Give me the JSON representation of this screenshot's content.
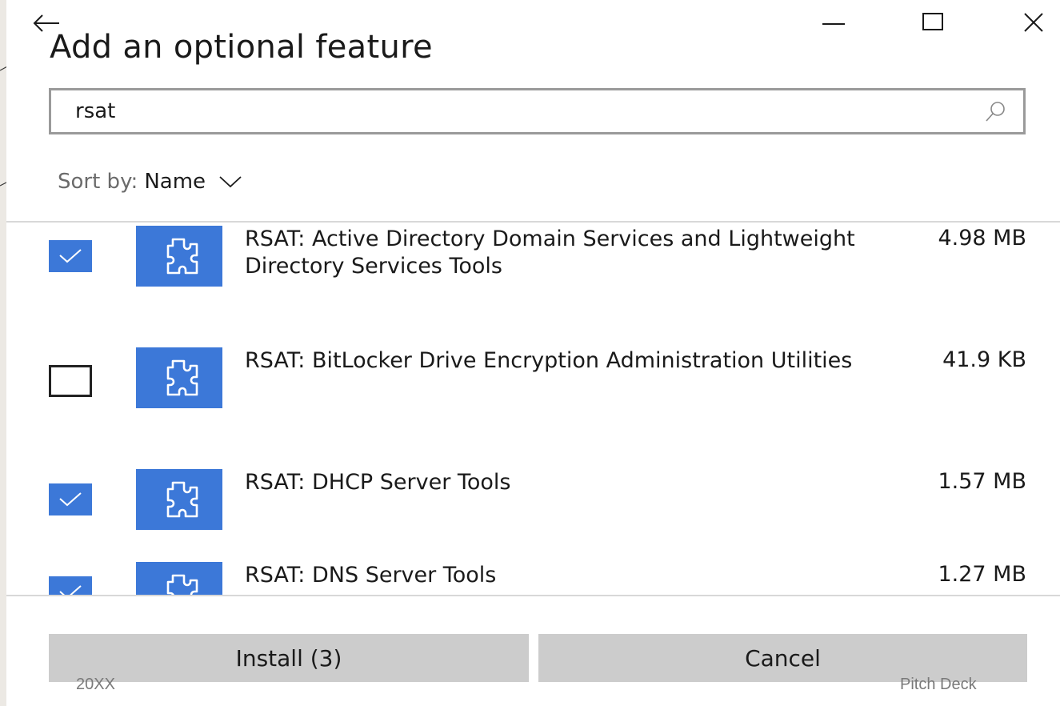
{
  "window": {
    "title": "Add an optional feature",
    "controls": [
      "minimize-icon",
      "maximize-icon",
      "close-icon"
    ],
    "back_icon": "arrow-left-icon"
  },
  "search": {
    "value": "rsat",
    "placeholder": "",
    "icon": "search-icon"
  },
  "sort": {
    "label": "Sort by:",
    "value": "Name",
    "icon": "chevron-down-icon"
  },
  "features": [
    {
      "name": "RSAT: Active Directory Domain Services and Lightweight Directory Services Tools",
      "size": "4.98 MB",
      "checked": true,
      "icon": "puzzle-icon"
    },
    {
      "name": "RSAT: BitLocker Drive Encryption Administration Utilities",
      "size": "41.9 KB",
      "checked": false,
      "icon": "puzzle-icon"
    },
    {
      "name": "RSAT: DHCP Server Tools",
      "size": "1.57 MB",
      "checked": true,
      "icon": "puzzle-icon"
    },
    {
      "name": "RSAT: DNS Server Tools",
      "size": "1.27 MB",
      "checked": true,
      "icon": "puzzle-icon"
    }
  ],
  "buttons": {
    "install": "Install (3)",
    "cancel": "Cancel"
  },
  "footer": {
    "left": "20XX",
    "right": "Pitch Deck"
  },
  "colors": {
    "accent": "#3c78d8",
    "button_bg": "#cccccc",
    "background": "#ece9e4"
  }
}
